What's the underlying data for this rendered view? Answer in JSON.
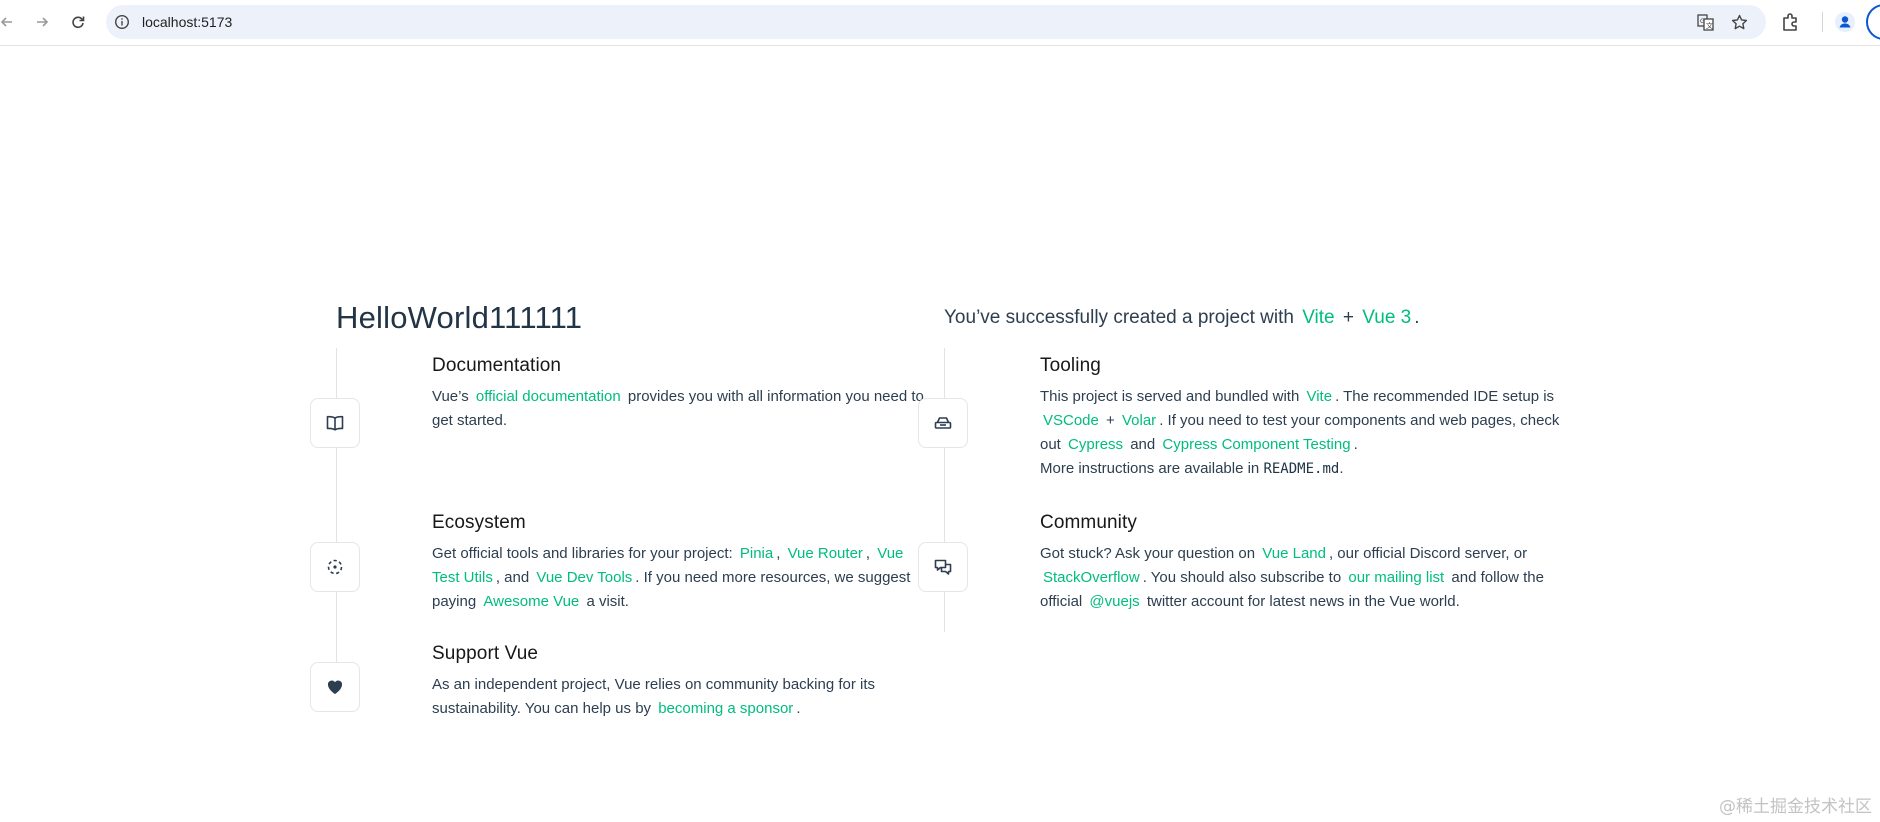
{
  "browser": {
    "url": "localhost:5173"
  },
  "hero": {
    "title": "HelloWorld111111",
    "greeting_prefix": "You’ve successfully created a project with",
    "vite": "Vite",
    "plus": "+",
    "vue3": "Vue 3",
    "period": "."
  },
  "items": {
    "documentation": {
      "heading": "Documentation",
      "t1": "Vue’s",
      "link1": "official documentation",
      "t2": "provides you with all information you need to get started."
    },
    "tooling": {
      "heading": "Tooling",
      "t1": "This project is served and bundled with",
      "link1": "Vite",
      "t2": ". The recommended IDE setup is",
      "link2": "VSCode",
      "t3": "+",
      "link3": "Volar",
      "t4": ". If you need to test your components and web pages, check out",
      "link4": "Cypress",
      "t5": "and",
      "link5": "Cypress Component Testing",
      "t6": ".",
      "t7": "More instructions are available in",
      "code": "README.md",
      "t8": "."
    },
    "ecosystem": {
      "heading": "Ecosystem",
      "t1": "Get official tools and libraries for your project:",
      "link1": "Pinia",
      "c1": ",",
      "link2": "Vue Router",
      "c2": ",",
      "link3": "Vue Test Utils",
      "c3": ", and",
      "link4": "Vue Dev Tools",
      "t2": ". If you need more resources, we suggest paying",
      "link5": "Awesome Vue",
      "t3": "a visit."
    },
    "community": {
      "heading": "Community",
      "t1": "Got stuck? Ask your question on",
      "link1": "Vue Land",
      "t2": ", our official Discord server, or",
      "link2": "StackOverflow",
      "t3": ". You should also subscribe to",
      "link3": "our mailing list",
      "t4": "and follow the official",
      "link4": "@vuejs",
      "t5": "twitter account for latest news in the Vue world."
    },
    "support": {
      "heading": "Support Vue",
      "t1": "As an independent project, Vue relies on community backing for its sustainability. You can help us by",
      "link1": "becoming a sponsor",
      "t2": "."
    }
  },
  "icons": {
    "back": "arrow-left-icon",
    "forward": "arrow-right-icon",
    "reload": "reload-icon",
    "site_info": "info-icon",
    "translate": "translate-icon",
    "bookmark": "star-icon",
    "extensions": "puzzle-icon",
    "profile": "person-icon",
    "documentation": "book-icon",
    "tooling": "toolbox-icon",
    "ecosystem": "ecosystem-icon",
    "community": "chat-bubbles-icon",
    "support": "heart-icon"
  },
  "watermark": "@稀土掘金技术社区",
  "colors": {
    "link": "#00bd7e",
    "heading": "#181818",
    "text": "#2c3e50"
  }
}
